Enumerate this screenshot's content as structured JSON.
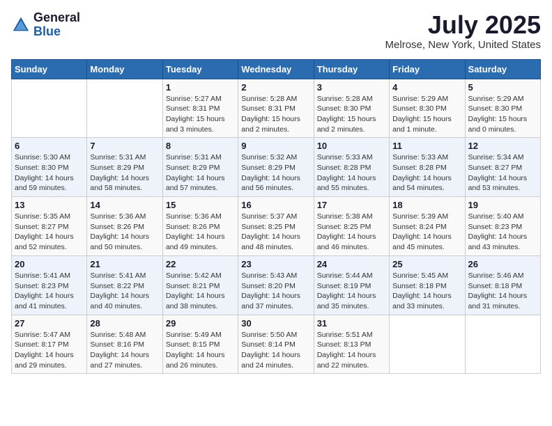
{
  "header": {
    "logo_general": "General",
    "logo_blue": "Blue",
    "title": "July 2025",
    "subtitle": "Melrose, New York, United States"
  },
  "days_of_week": [
    "Sunday",
    "Monday",
    "Tuesday",
    "Wednesday",
    "Thursday",
    "Friday",
    "Saturday"
  ],
  "weeks": [
    [
      {
        "day": "",
        "info": ""
      },
      {
        "day": "",
        "info": ""
      },
      {
        "day": "1",
        "info": "Sunrise: 5:27 AM\nSunset: 8:31 PM\nDaylight: 15 hours and 3 minutes."
      },
      {
        "day": "2",
        "info": "Sunrise: 5:28 AM\nSunset: 8:31 PM\nDaylight: 15 hours and 2 minutes."
      },
      {
        "day": "3",
        "info": "Sunrise: 5:28 AM\nSunset: 8:30 PM\nDaylight: 15 hours and 2 minutes."
      },
      {
        "day": "4",
        "info": "Sunrise: 5:29 AM\nSunset: 8:30 PM\nDaylight: 15 hours and 1 minute."
      },
      {
        "day": "5",
        "info": "Sunrise: 5:29 AM\nSunset: 8:30 PM\nDaylight: 15 hours and 0 minutes."
      }
    ],
    [
      {
        "day": "6",
        "info": "Sunrise: 5:30 AM\nSunset: 8:30 PM\nDaylight: 14 hours and 59 minutes."
      },
      {
        "day": "7",
        "info": "Sunrise: 5:31 AM\nSunset: 8:29 PM\nDaylight: 14 hours and 58 minutes."
      },
      {
        "day": "8",
        "info": "Sunrise: 5:31 AM\nSunset: 8:29 PM\nDaylight: 14 hours and 57 minutes."
      },
      {
        "day": "9",
        "info": "Sunrise: 5:32 AM\nSunset: 8:29 PM\nDaylight: 14 hours and 56 minutes."
      },
      {
        "day": "10",
        "info": "Sunrise: 5:33 AM\nSunset: 8:28 PM\nDaylight: 14 hours and 55 minutes."
      },
      {
        "day": "11",
        "info": "Sunrise: 5:33 AM\nSunset: 8:28 PM\nDaylight: 14 hours and 54 minutes."
      },
      {
        "day": "12",
        "info": "Sunrise: 5:34 AM\nSunset: 8:27 PM\nDaylight: 14 hours and 53 minutes."
      }
    ],
    [
      {
        "day": "13",
        "info": "Sunrise: 5:35 AM\nSunset: 8:27 PM\nDaylight: 14 hours and 52 minutes."
      },
      {
        "day": "14",
        "info": "Sunrise: 5:36 AM\nSunset: 8:26 PM\nDaylight: 14 hours and 50 minutes."
      },
      {
        "day": "15",
        "info": "Sunrise: 5:36 AM\nSunset: 8:26 PM\nDaylight: 14 hours and 49 minutes."
      },
      {
        "day": "16",
        "info": "Sunrise: 5:37 AM\nSunset: 8:25 PM\nDaylight: 14 hours and 48 minutes."
      },
      {
        "day": "17",
        "info": "Sunrise: 5:38 AM\nSunset: 8:25 PM\nDaylight: 14 hours and 46 minutes."
      },
      {
        "day": "18",
        "info": "Sunrise: 5:39 AM\nSunset: 8:24 PM\nDaylight: 14 hours and 45 minutes."
      },
      {
        "day": "19",
        "info": "Sunrise: 5:40 AM\nSunset: 8:23 PM\nDaylight: 14 hours and 43 minutes."
      }
    ],
    [
      {
        "day": "20",
        "info": "Sunrise: 5:41 AM\nSunset: 8:23 PM\nDaylight: 14 hours and 41 minutes."
      },
      {
        "day": "21",
        "info": "Sunrise: 5:41 AM\nSunset: 8:22 PM\nDaylight: 14 hours and 40 minutes."
      },
      {
        "day": "22",
        "info": "Sunrise: 5:42 AM\nSunset: 8:21 PM\nDaylight: 14 hours and 38 minutes."
      },
      {
        "day": "23",
        "info": "Sunrise: 5:43 AM\nSunset: 8:20 PM\nDaylight: 14 hours and 37 minutes."
      },
      {
        "day": "24",
        "info": "Sunrise: 5:44 AM\nSunset: 8:19 PM\nDaylight: 14 hours and 35 minutes."
      },
      {
        "day": "25",
        "info": "Sunrise: 5:45 AM\nSunset: 8:18 PM\nDaylight: 14 hours and 33 minutes."
      },
      {
        "day": "26",
        "info": "Sunrise: 5:46 AM\nSunset: 8:18 PM\nDaylight: 14 hours and 31 minutes."
      }
    ],
    [
      {
        "day": "27",
        "info": "Sunrise: 5:47 AM\nSunset: 8:17 PM\nDaylight: 14 hours and 29 minutes."
      },
      {
        "day": "28",
        "info": "Sunrise: 5:48 AM\nSunset: 8:16 PM\nDaylight: 14 hours and 27 minutes."
      },
      {
        "day": "29",
        "info": "Sunrise: 5:49 AM\nSunset: 8:15 PM\nDaylight: 14 hours and 26 minutes."
      },
      {
        "day": "30",
        "info": "Sunrise: 5:50 AM\nSunset: 8:14 PM\nDaylight: 14 hours and 24 minutes."
      },
      {
        "day": "31",
        "info": "Sunrise: 5:51 AM\nSunset: 8:13 PM\nDaylight: 14 hours and 22 minutes."
      },
      {
        "day": "",
        "info": ""
      },
      {
        "day": "",
        "info": ""
      }
    ]
  ]
}
